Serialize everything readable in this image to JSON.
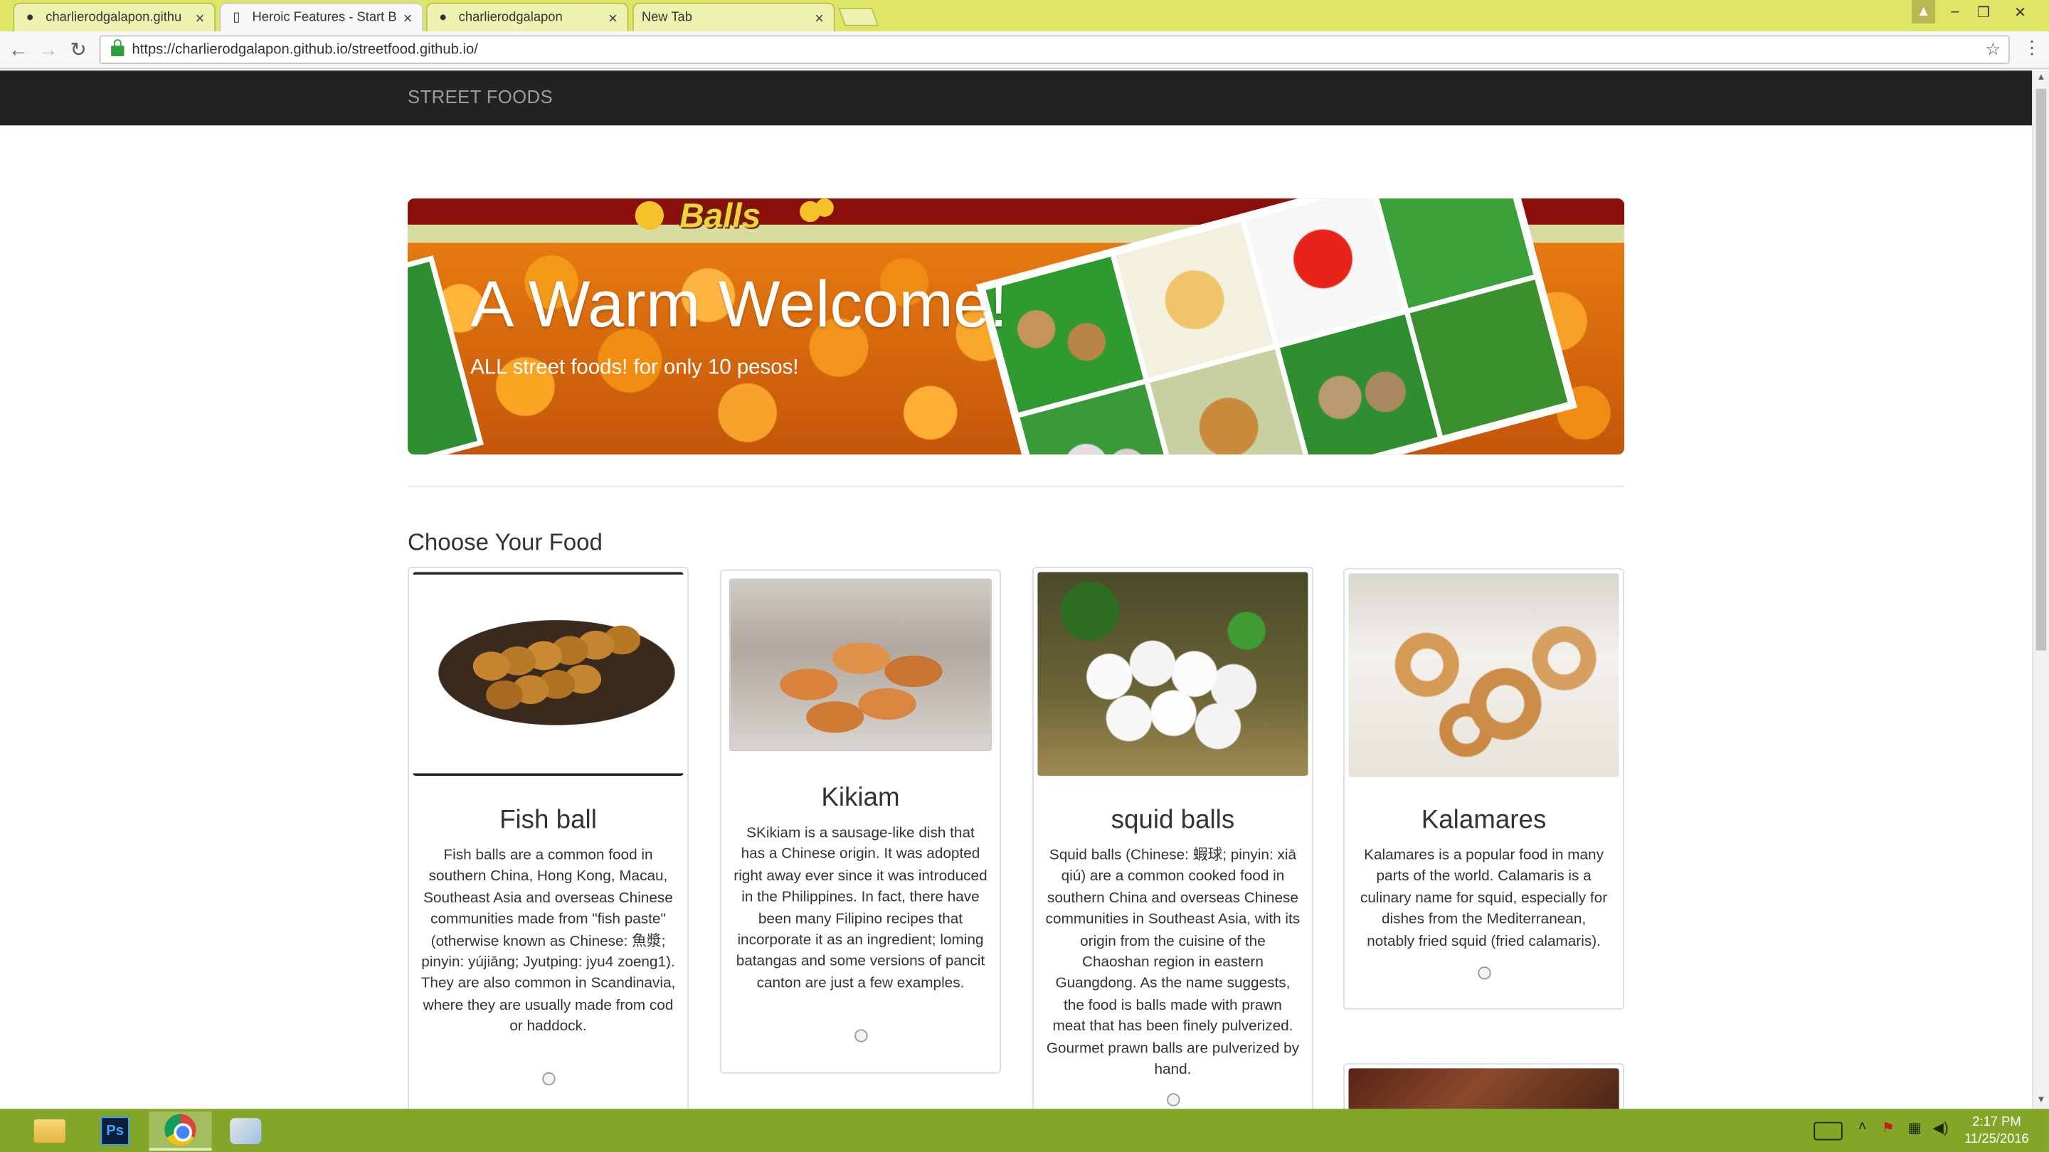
{
  "browser": {
    "tabs": [
      {
        "title": "charlierodgalapon.githu",
        "icon": "github-icon",
        "active": false
      },
      {
        "title": "Heroic Features - Start B",
        "icon": "page-icon",
        "active": true
      },
      {
        "title": "charlierodgalapon",
        "icon": "github-icon",
        "active": false
      },
      {
        "title": "New Tab",
        "icon": "",
        "active": false
      }
    ],
    "url": "https://charlierodgalapon.github.io/streetfood.github.io/"
  },
  "navbar": {
    "brand": "STREET FOODS"
  },
  "hero": {
    "logo_text": "Balls",
    "title": "A Warm Welcome!",
    "subtitle": "ALL street foods! for only 10 pesos!"
  },
  "section": {
    "title": "Choose Your Food"
  },
  "foods": [
    {
      "name": "Fish ball",
      "description": "Fish balls are a common food in southern China, Hong Kong, Macau, Southeast Asia and overseas Chinese communities made from \"fish paste\" (otherwise known as Chinese: 魚漿; pinyin: yújiāng; Jyutping: jyu4 zoeng1). They are also common in Scandinavia, where they are usually made from cod or haddock."
    },
    {
      "name": "Kikiam",
      "description": "SKikiam is a sausage-like dish that has a Chinese origin. It was adopted right away ever since it was introduced in the Philippines. In fact, there have been many Filipino recipes that incorporate it as an ingredient; loming batangas and some versions of pancit canton are just a few examples."
    },
    {
      "name": "squid balls",
      "description": "Squid balls (Chinese: 蝦球; pinyin: xiā qiú) are a common cooked food in southern China and overseas Chinese communities in Southeast Asia, with its origin from the cuisine of the Chaoshan region in eastern Guangdong. As the name suggests, the food is balls made with prawn meat that has been finely pulverized. Gourmet prawn balls are pulverized by hand."
    },
    {
      "name": "Kalamares",
      "description": "Kalamares is a popular food in many parts of the world. Calamaris is a culinary name for squid, especially for dishes from the Mediterranean, notably fried squid (fried calamaris)."
    }
  ],
  "taskbar": {
    "apps": [
      "file-explorer-icon",
      "photoshop-icon",
      "chrome-icon",
      "paint-icon"
    ],
    "ps_label": "Ps",
    "time": "2:17 PM",
    "date": "11/25/2016"
  },
  "colors": {
    "tabstrip": "#dfe666",
    "navbar": "#222222",
    "taskbar": "#84a628"
  }
}
